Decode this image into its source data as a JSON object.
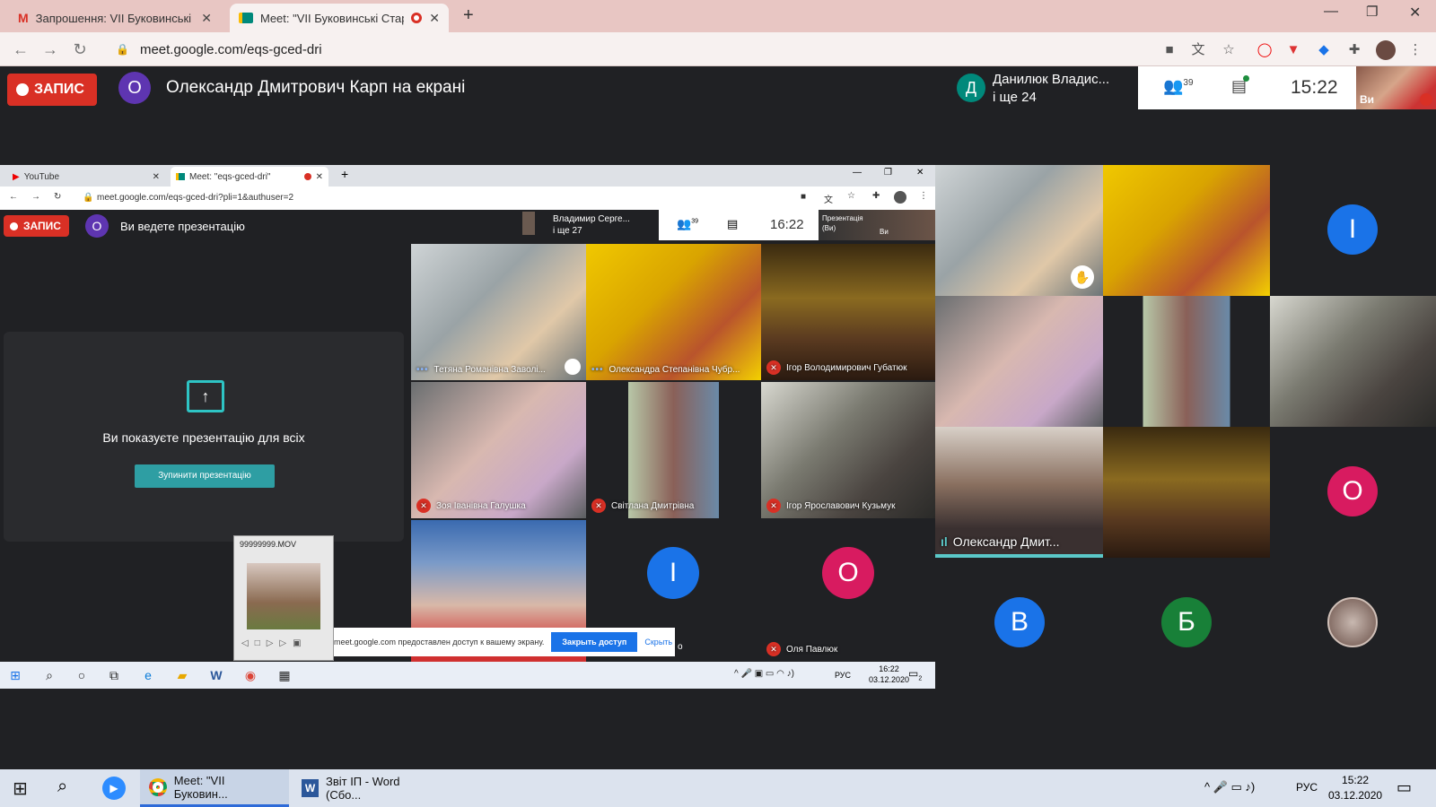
{
  "browser": {
    "tabs": [
      {
        "label": "Запрошення: VII Буковинські Ст",
        "icon": "gmail-icon"
      },
      {
        "label": "Meet: \"VII Буковинські Стар",
        "icon": "meet-icon"
      }
    ],
    "url": "meet.google.com/eqs-gced-dri"
  },
  "meet": {
    "record_label": "ЗАПИС",
    "presenter_initial": "О",
    "presenter_text": "Олександр Дмитрович Карп на екрані",
    "pinned_initial": "Д",
    "pinned_name": "Данилюк Владис...",
    "pinned_more": "і ще 24",
    "participants_count": "39",
    "time": "15:22",
    "self_label": "Ви"
  },
  "inner": {
    "tabs": [
      "YouTube",
      "Meet: \"eqs-gced-dri\""
    ],
    "url": "meet.google.com/eqs-gced-dri?pli=1&authuser=2",
    "record_label": "ЗАПИС",
    "self_initial": "О",
    "presenting_status": "Ви ведете презентацію",
    "pinned_name": "Владимир Серге...",
    "pinned_more": "і ще 27",
    "participants_count": "39",
    "time": "16:22",
    "self_label_top": "Презентація",
    "self_label_bottom": "(Ви)",
    "self_short": "Ви",
    "panel_text": "Ви показуєте презентацію для всіх",
    "stop_button": "Зупинити презентацію",
    "tiles": [
      {
        "name": "Тетяна Романівна Заволі...",
        "status": "speaking"
      },
      {
        "name": "Олександра Степанівна Чубр...",
        "status": "speaking"
      },
      {
        "name": "Ігор Володимирович Губатюк",
        "status": "muted"
      },
      {
        "name": "Зоя Іванівна Галушка",
        "status": "muted"
      },
      {
        "name": "Світлана Дмитрівна",
        "status": "muted"
      },
      {
        "name": "Ігор Ярославович Кузьмук",
        "status": "muted"
      },
      {
        "name": "",
        "status": "none"
      },
      {
        "name": "",
        "status": "avatar",
        "initial": "І"
      },
      {
        "name": "Оля Павлюк",
        "status": "muted",
        "initial": "О"
      }
    ],
    "share_bar": {
      "text": "meet.google.com предоставлен доступ к вашему экрану.",
      "primary": "Закрыть доступ",
      "secondary": "Скрыть",
      "hidden_tail": "о"
    },
    "media_popup": {
      "title": "99999999.MOV"
    },
    "taskbar": {
      "lang": "РУС",
      "time": "16:22",
      "date": "03.12.2020",
      "badge": "2"
    }
  },
  "grid": {
    "tiles": [
      {
        "name": "",
        "kind": "video"
      },
      {
        "name": "",
        "kind": "video"
      },
      {
        "name": "",
        "kind": "avatar",
        "initial": "І",
        "color": "#1a73e8"
      },
      {
        "name": "",
        "kind": "video"
      },
      {
        "name": "",
        "kind": "video"
      },
      {
        "name": "",
        "kind": "video"
      },
      {
        "name": "Олександр Дмит...",
        "kind": "video",
        "speaking": true
      },
      {
        "name": "",
        "kind": "video"
      },
      {
        "name": "",
        "kind": "avatar",
        "initial": "О",
        "color": "#d81b60"
      },
      {
        "name": "",
        "kind": "avatar",
        "initial": "В",
        "color": "#1a73e8"
      },
      {
        "name": "",
        "kind": "avatar",
        "initial": "Б",
        "color": "#188038"
      },
      {
        "name": "",
        "kind": "coin"
      }
    ]
  },
  "taskbar": {
    "apps": [
      {
        "label": "Meet: \"VII Буковин...",
        "icon": "chrome-icon"
      },
      {
        "label": "Звіт ІП - Word (Сбо...",
        "icon": "word-icon"
      }
    ],
    "lang": "РУС",
    "time": "15:22",
    "date": "03.12.2020"
  }
}
